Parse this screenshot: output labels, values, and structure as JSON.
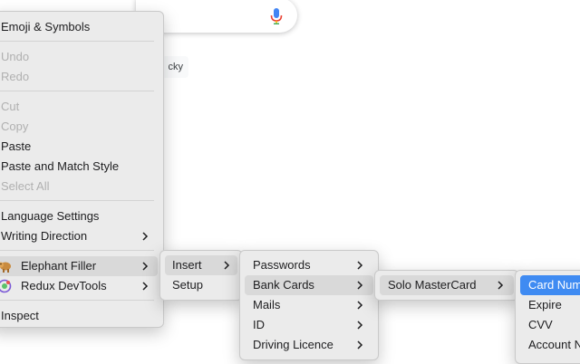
{
  "background": {
    "chip_text": "cky"
  },
  "context_menu": {
    "items": [
      {
        "label": "Emoji & Symbols"
      },
      {
        "label": "Undo"
      },
      {
        "label": "Redo"
      },
      {
        "label": "Cut"
      },
      {
        "label": "Copy"
      },
      {
        "label": "Paste"
      },
      {
        "label": "Paste and Match Style"
      },
      {
        "label": "Select All"
      },
      {
        "label": "Language Settings"
      },
      {
        "label": "Writing Direction"
      },
      {
        "label": "Elephant Filler"
      },
      {
        "label": "Redux DevTools"
      },
      {
        "label": "Inspect"
      }
    ]
  },
  "elephant_submenu": {
    "items": [
      {
        "label": "Insert"
      },
      {
        "label": "Setup"
      }
    ]
  },
  "insert_submenu": {
    "items": [
      {
        "label": "Passwords"
      },
      {
        "label": "Bank Cards"
      },
      {
        "label": "Mails"
      },
      {
        "label": "ID"
      },
      {
        "label": "Driving Licence"
      }
    ]
  },
  "bank_cards_submenu": {
    "items": [
      {
        "label": "Solo MasterCard"
      }
    ]
  },
  "card_submenu": {
    "items": [
      {
        "label": "Card Num"
      },
      {
        "label": "Expire"
      },
      {
        "label": "CVV"
      },
      {
        "label": "Account N"
      }
    ]
  },
  "colors": {
    "highlight_blue": "#3f8bf2",
    "menu_bg": "#ebebeb",
    "disabled_text": "#b0b0b0"
  },
  "icons": {
    "mic": "mic-icon",
    "submenu_arrow": "chevron-right-icon",
    "elephant": "elephant-icon",
    "redux": "redux-icon"
  }
}
